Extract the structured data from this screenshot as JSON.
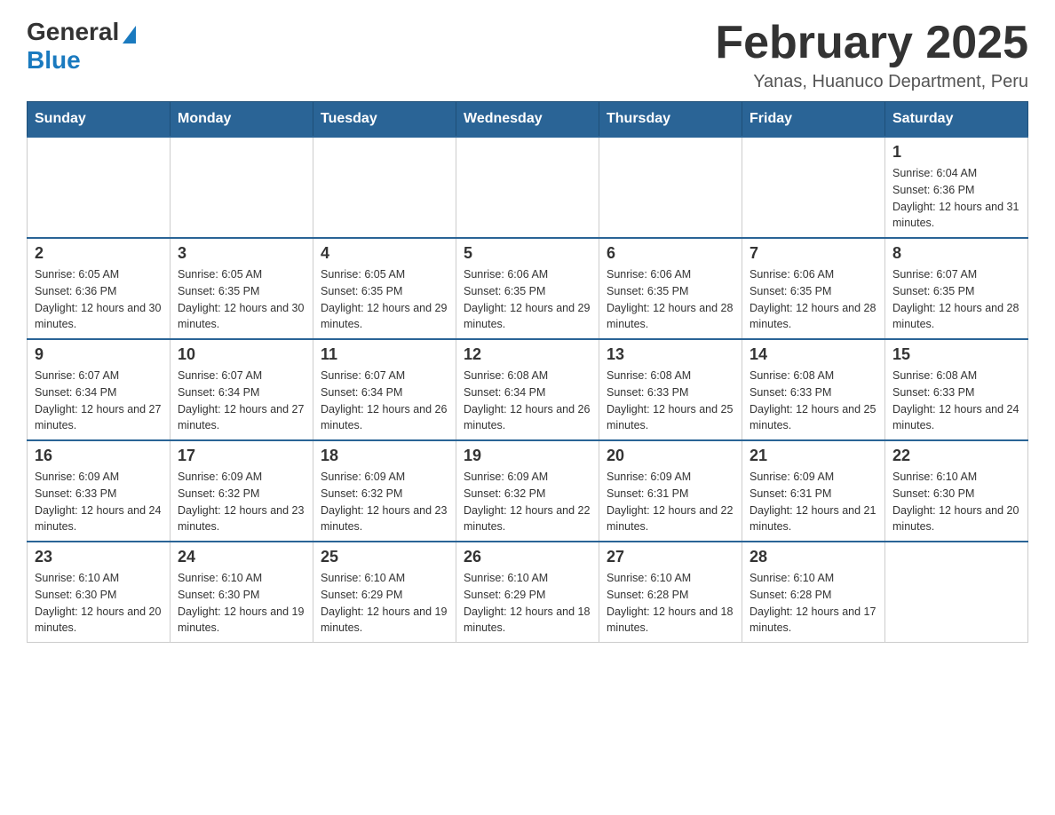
{
  "header": {
    "logo_general": "General",
    "logo_blue": "Blue",
    "month_title": "February 2025",
    "location": "Yanas, Huanuco Department, Peru"
  },
  "days_of_week": [
    "Sunday",
    "Monday",
    "Tuesday",
    "Wednesday",
    "Thursday",
    "Friday",
    "Saturday"
  ],
  "weeks": [
    [
      {
        "day": "",
        "info": ""
      },
      {
        "day": "",
        "info": ""
      },
      {
        "day": "",
        "info": ""
      },
      {
        "day": "",
        "info": ""
      },
      {
        "day": "",
        "info": ""
      },
      {
        "day": "",
        "info": ""
      },
      {
        "day": "1",
        "info": "Sunrise: 6:04 AM\nSunset: 6:36 PM\nDaylight: 12 hours and 31 minutes."
      }
    ],
    [
      {
        "day": "2",
        "info": "Sunrise: 6:05 AM\nSunset: 6:36 PM\nDaylight: 12 hours and 30 minutes."
      },
      {
        "day": "3",
        "info": "Sunrise: 6:05 AM\nSunset: 6:35 PM\nDaylight: 12 hours and 30 minutes."
      },
      {
        "day": "4",
        "info": "Sunrise: 6:05 AM\nSunset: 6:35 PM\nDaylight: 12 hours and 29 minutes."
      },
      {
        "day": "5",
        "info": "Sunrise: 6:06 AM\nSunset: 6:35 PM\nDaylight: 12 hours and 29 minutes."
      },
      {
        "day": "6",
        "info": "Sunrise: 6:06 AM\nSunset: 6:35 PM\nDaylight: 12 hours and 28 minutes."
      },
      {
        "day": "7",
        "info": "Sunrise: 6:06 AM\nSunset: 6:35 PM\nDaylight: 12 hours and 28 minutes."
      },
      {
        "day": "8",
        "info": "Sunrise: 6:07 AM\nSunset: 6:35 PM\nDaylight: 12 hours and 28 minutes."
      }
    ],
    [
      {
        "day": "9",
        "info": "Sunrise: 6:07 AM\nSunset: 6:34 PM\nDaylight: 12 hours and 27 minutes."
      },
      {
        "day": "10",
        "info": "Sunrise: 6:07 AM\nSunset: 6:34 PM\nDaylight: 12 hours and 27 minutes."
      },
      {
        "day": "11",
        "info": "Sunrise: 6:07 AM\nSunset: 6:34 PM\nDaylight: 12 hours and 26 minutes."
      },
      {
        "day": "12",
        "info": "Sunrise: 6:08 AM\nSunset: 6:34 PM\nDaylight: 12 hours and 26 minutes."
      },
      {
        "day": "13",
        "info": "Sunrise: 6:08 AM\nSunset: 6:33 PM\nDaylight: 12 hours and 25 minutes."
      },
      {
        "day": "14",
        "info": "Sunrise: 6:08 AM\nSunset: 6:33 PM\nDaylight: 12 hours and 25 minutes."
      },
      {
        "day": "15",
        "info": "Sunrise: 6:08 AM\nSunset: 6:33 PM\nDaylight: 12 hours and 24 minutes."
      }
    ],
    [
      {
        "day": "16",
        "info": "Sunrise: 6:09 AM\nSunset: 6:33 PM\nDaylight: 12 hours and 24 minutes."
      },
      {
        "day": "17",
        "info": "Sunrise: 6:09 AM\nSunset: 6:32 PM\nDaylight: 12 hours and 23 minutes."
      },
      {
        "day": "18",
        "info": "Sunrise: 6:09 AM\nSunset: 6:32 PM\nDaylight: 12 hours and 23 minutes."
      },
      {
        "day": "19",
        "info": "Sunrise: 6:09 AM\nSunset: 6:32 PM\nDaylight: 12 hours and 22 minutes."
      },
      {
        "day": "20",
        "info": "Sunrise: 6:09 AM\nSunset: 6:31 PM\nDaylight: 12 hours and 22 minutes."
      },
      {
        "day": "21",
        "info": "Sunrise: 6:09 AM\nSunset: 6:31 PM\nDaylight: 12 hours and 21 minutes."
      },
      {
        "day": "22",
        "info": "Sunrise: 6:10 AM\nSunset: 6:30 PM\nDaylight: 12 hours and 20 minutes."
      }
    ],
    [
      {
        "day": "23",
        "info": "Sunrise: 6:10 AM\nSunset: 6:30 PM\nDaylight: 12 hours and 20 minutes."
      },
      {
        "day": "24",
        "info": "Sunrise: 6:10 AM\nSunset: 6:30 PM\nDaylight: 12 hours and 19 minutes."
      },
      {
        "day": "25",
        "info": "Sunrise: 6:10 AM\nSunset: 6:29 PM\nDaylight: 12 hours and 19 minutes."
      },
      {
        "day": "26",
        "info": "Sunrise: 6:10 AM\nSunset: 6:29 PM\nDaylight: 12 hours and 18 minutes."
      },
      {
        "day": "27",
        "info": "Sunrise: 6:10 AM\nSunset: 6:28 PM\nDaylight: 12 hours and 18 minutes."
      },
      {
        "day": "28",
        "info": "Sunrise: 6:10 AM\nSunset: 6:28 PM\nDaylight: 12 hours and 17 minutes."
      },
      {
        "day": "",
        "info": ""
      }
    ]
  ]
}
